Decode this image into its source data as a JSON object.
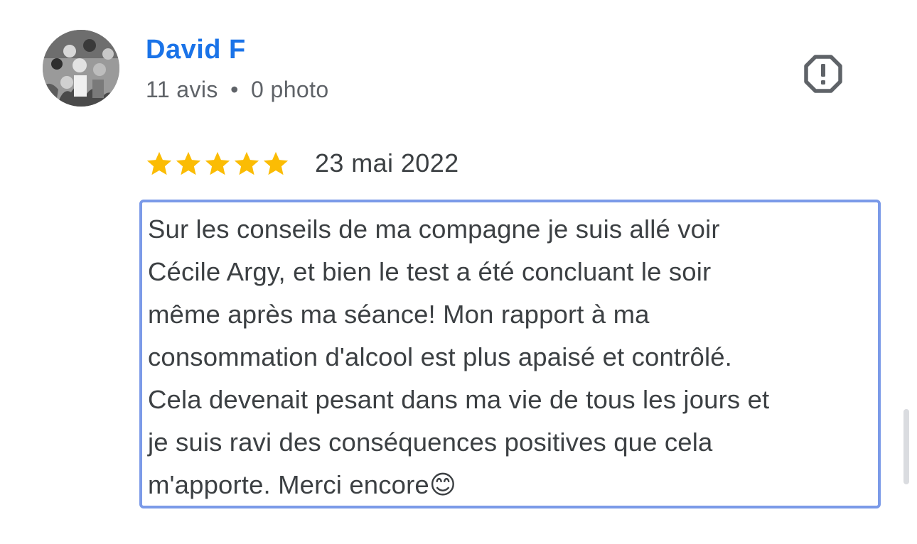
{
  "reviewer": {
    "name": "David F",
    "review_count": "11 avis",
    "separator": "•",
    "photo_count": "0 photo",
    "avatar_icon": "user-photo-avatar"
  },
  "actions": {
    "report_icon": "report-flag-icon"
  },
  "review": {
    "rating": 5,
    "max_rating": 5,
    "star_color": "#fbbc04",
    "date": "23 mai 2022",
    "text": "Sur les conseils de ma compagne je suis allé voir\nCécile Argy, et bien le test a été concluant le soir\nmême après ma séance! Mon rapport à ma\nconsommation d'alcool est plus apaisé et contrôlé.\nCela devenait pesant dans ma vie de tous les jours et\nje suis ravi des conséquences positives que cela\nm'apporte. Merci encore😊"
  },
  "colors": {
    "name": "#1a73e8",
    "meta": "#5f6368",
    "text": "#3c4043",
    "highlight_border": "#7b9ae8"
  }
}
